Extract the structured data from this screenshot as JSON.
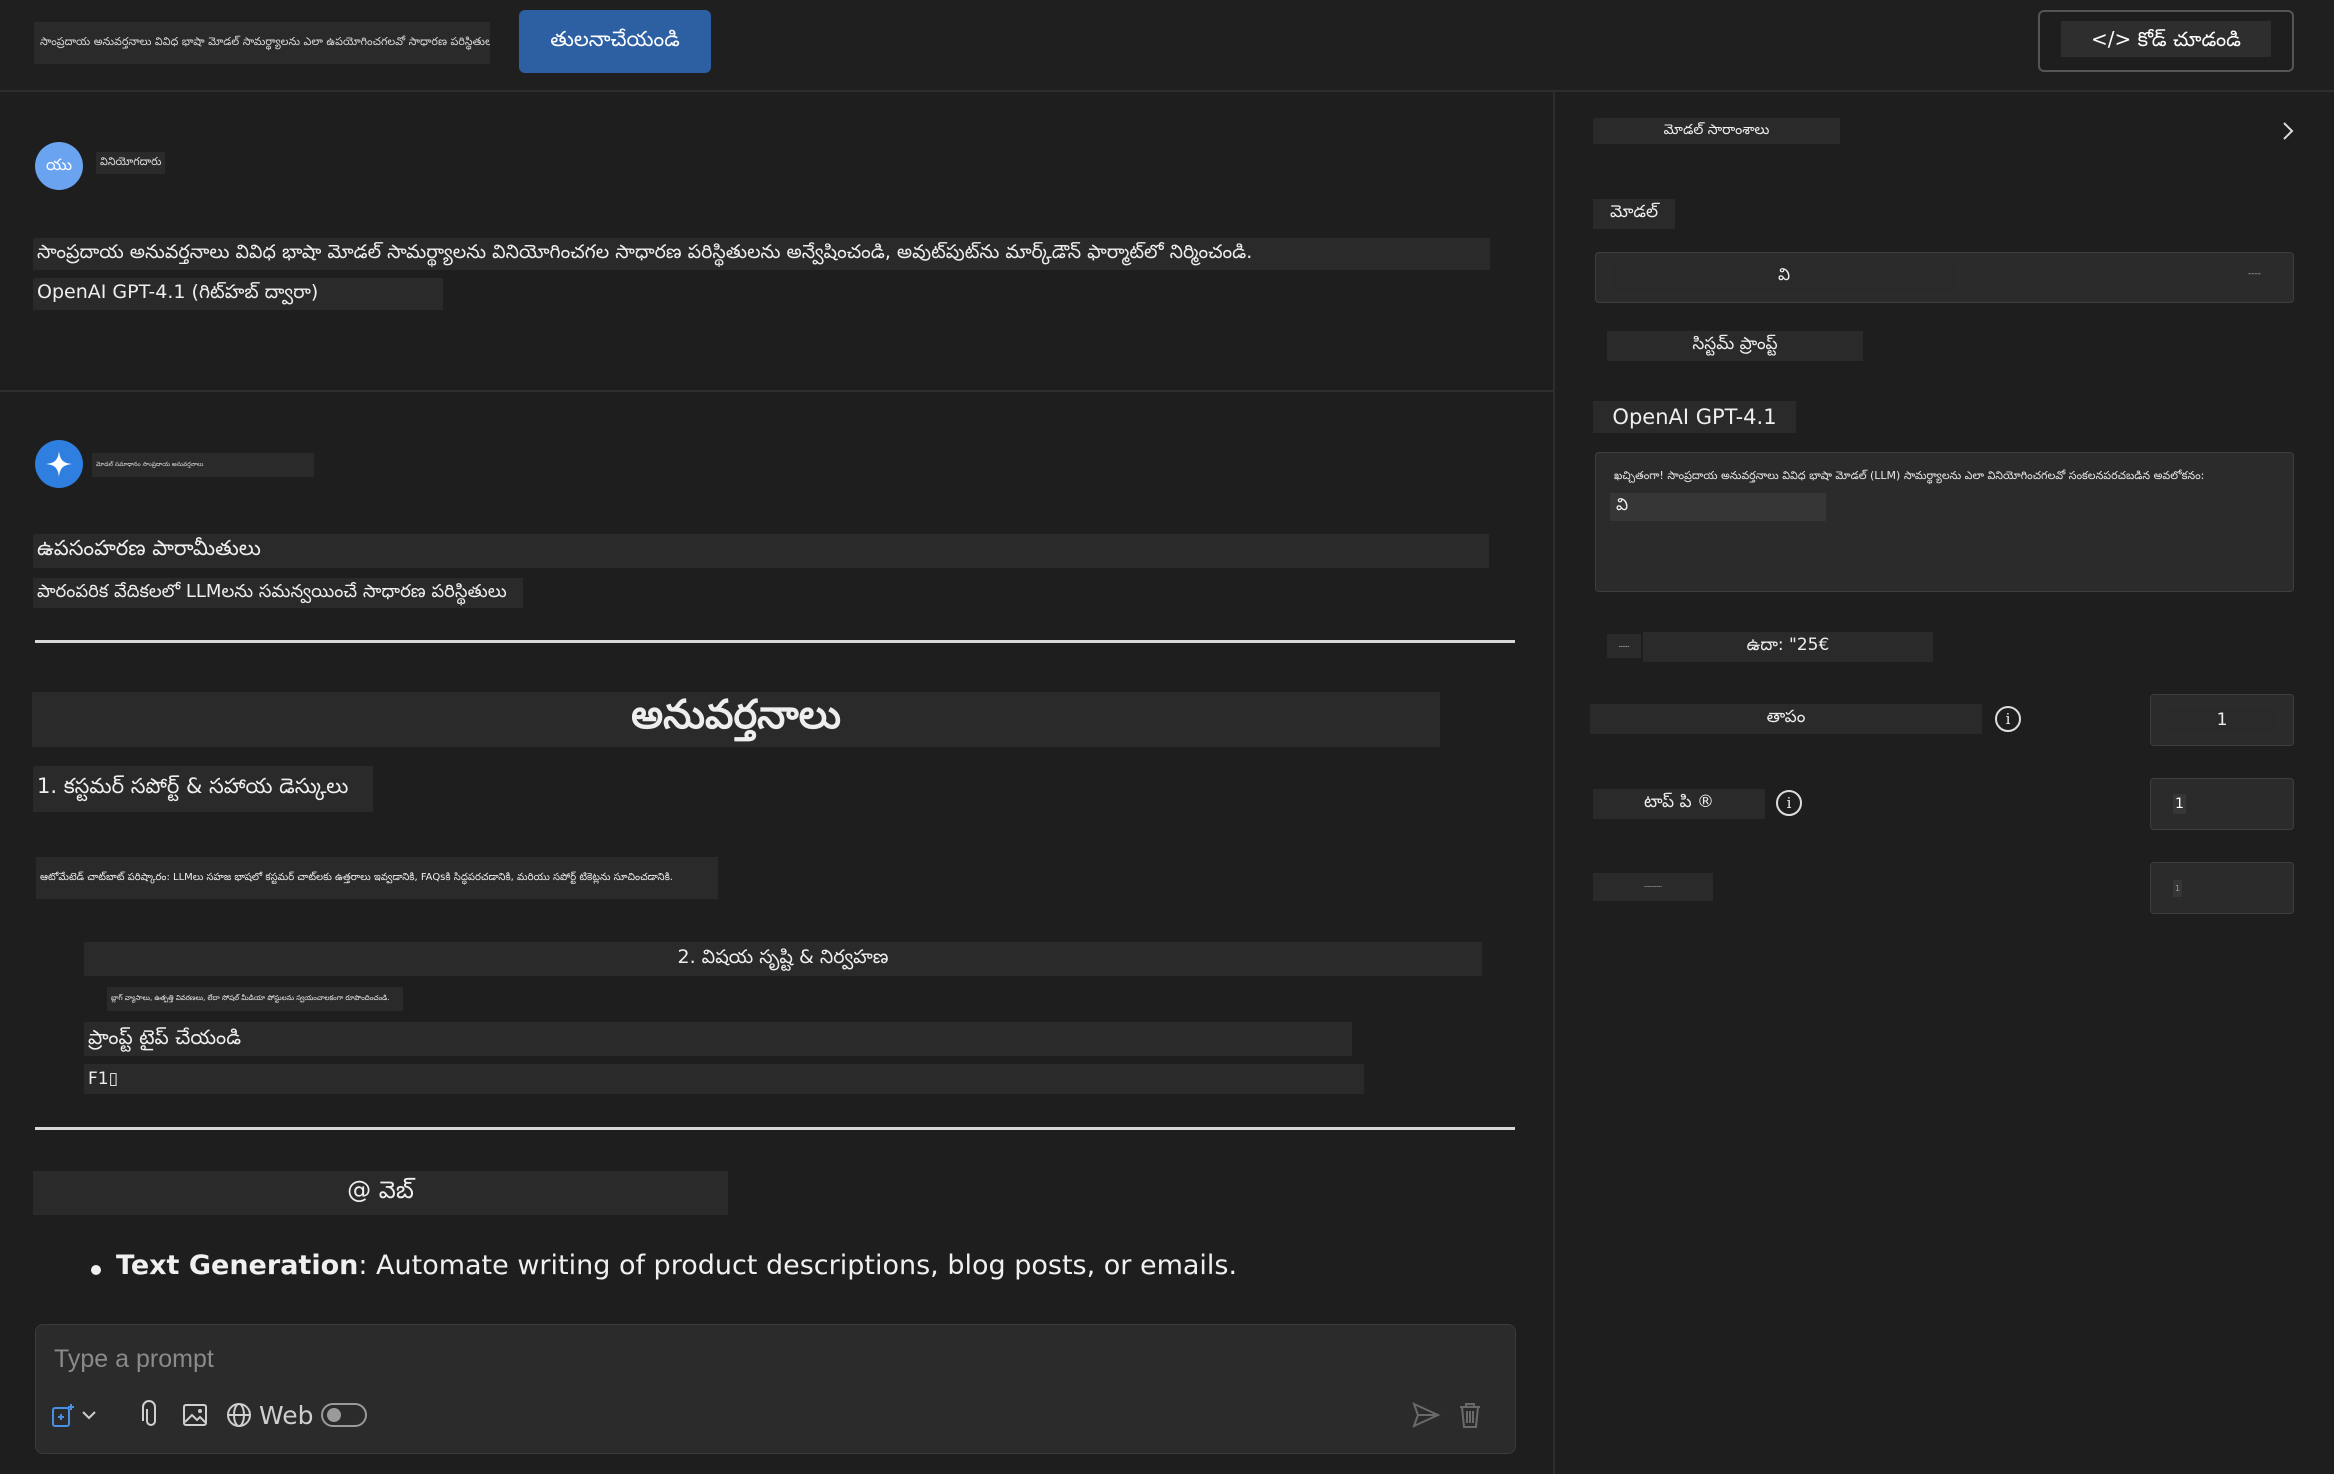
{
  "topbar": {
    "compare_input_value": "సాంప్రదాయ అనువర్తనాలు వివిధ భాషా మోడల్ సామర్థ్యాలను ఎలా ఉపయోగించగలవో సాధారణ పరిస్థితులను అన్వేషించండి",
    "compare_button": "తులనాచేయండి",
    "view_code_button": "</> కోడ్ చూడండి"
  },
  "user_message": {
    "avatar": "యు",
    "name": "వినియోగదారు",
    "text": "సాంప్రదాయ అనువర్తనాలు వివిధ భాషా మోడల్ సామర్థ్యాలను వినియోగించగల సాధారణ పరిస్థితులను అన్వేషించండి, అవుట్‌పుట్‌ను మార్క్‌డౌన్ ఫార్మాట్‌లో నిర్మించండి.",
    "model": "OpenAI GPT-4.1 (గిట్‌హబ్ ద్వారా)"
  },
  "ai_message": {
    "name": "మోడల్ సమాధానం సాంప్రదాయ అనువర్తనాలు",
    "section_title": "ఉపసంహరణ పారామీతులు",
    "subtitle": "పారంపరిక వేదికలలో LLMలను సమన్వయించే సాధారణ పరిస్థితులు",
    "heading": "అనువర్తనాలు",
    "item1_title": "1. కస్టమర్ సపోర్ట్ & సహాయ డెస్కులు",
    "item1_body": "ఆటోమేటెడ్ చాట్‌బాట్ పరిష్కారం: LLMలు సహజ భాషలో కస్టమర్ చాట్‌లకు ఉత్తరాలు ఇవ్వడానికి, FAQsకి సిద్ధపరచడానికి, మరియు సపోర్ట్ టికెట్లను సూచించడానికి.",
    "item2_title": "2. విషయ సృష్టి & నిర్వహణ",
    "item2_body": "బ్లాగ్ వ్యాసాలు, ఉత్పత్తి వివరణలు, లేదా సోషల్ మీడియా పోస్టులను స్వయంచాలకంగా రూపొందించండి.",
    "item2_prompt": "ప్రాంప్ట్ టైప్ చేయండి",
    "item2_code": "F1▯",
    "web_label": "@ వెబ్",
    "bullet_bold": "Text Generation",
    "bullet_text": ": Automate writing of product descriptions, blog posts, or emails."
  },
  "prompt": {
    "placeholder": "Type a prompt",
    "web_label": "Web"
  },
  "right_panel": {
    "header": "మోడల్ సారాంశాలు",
    "model_label": "మోడల్",
    "model_value": "వి",
    "model_badge": "----",
    "system_prompt_label": "సిస్టమ్ ప్రాంప్ట్",
    "model_name": "OpenAI GPT-4.1",
    "system_prompt_text": "ఖచ్చితంగా! సాంప్రదాయ అనువర్తనాలు వివిధ భాషా మోడల్ (LLM) సామర్థ్యాలను ఎలా వినియోగించగలవో సంకలనపరచబడిన అవలోకనం:",
    "system_prompt_line2": "వి",
    "example_tag": "-----",
    "example_text": "ఉదా: \"25€",
    "temperature_label": "తాపం",
    "temperature_value": "1",
    "top_p_label": "టాప్ పి ®",
    "top_p_value": "1",
    "third_label": "----------",
    "third_value": "1"
  }
}
